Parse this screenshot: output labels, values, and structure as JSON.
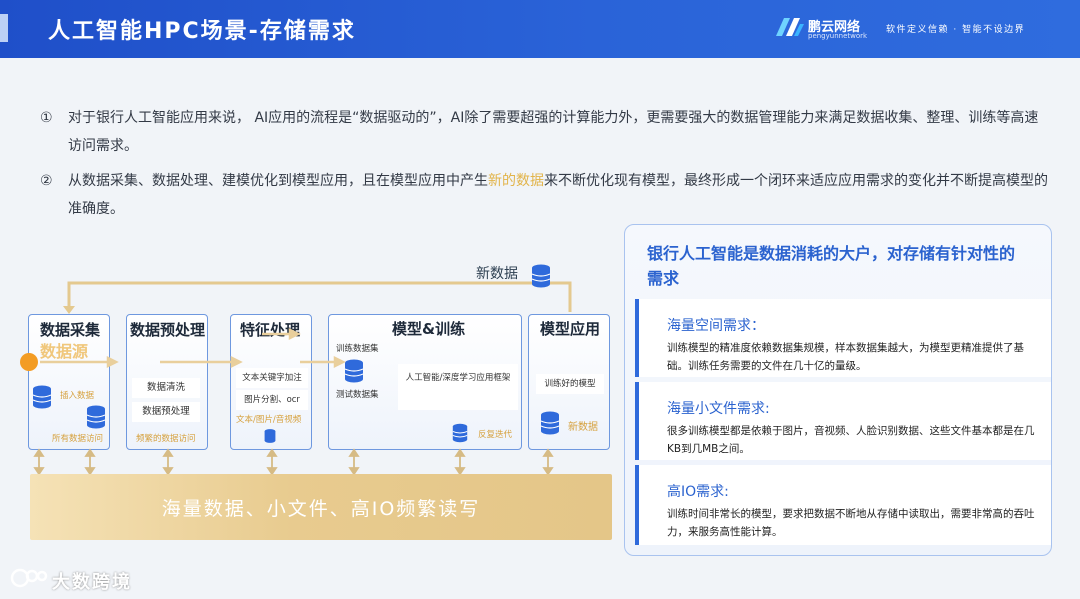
{
  "header": {
    "title": "人工智能HPC场景-存储需求",
    "brand": "鹏云网络",
    "brand_sub": "pengyunnetwork",
    "slogan": "软件定义信赖  ·  智能不设边界"
  },
  "points": [
    {
      "num": "①",
      "text": "对于银行人工智能应用来说， AI应用的流程是“数据驱动的”，AI除了需要超强的计算能力外，更需要强大的数据管理能力来满足数据收集、整理、训练等高速访问需求。"
    },
    {
      "num": "②",
      "text_before": "从数据采集、数据处理、建模优化到模型应用，且在模型应用中产生",
      "highlight": "新的数据",
      "text_after": "来不断优化现有模型，最终形成一个闭环来适应应用需求的变化并不断提高模型的准确度。"
    }
  ],
  "diagram": {
    "loop_label": "新数据",
    "collect": {
      "title": "数据采集",
      "big": "数据源",
      "insert": "插入数据",
      "access": "所有数据访问"
    },
    "preprocess": {
      "title": "数据预处理",
      "tags": [
        "数据清洗",
        "数据预处理"
      ],
      "frequent": "频繁的数据访问"
    },
    "feature": {
      "title": "特征处理",
      "items": [
        "文本关键字加注",
        "图片分割、ocr"
      ],
      "media": "文本/图片/音视频"
    },
    "train": {
      "title": "模型&训练",
      "train_set": "训练数据集",
      "test_set": "测试数据集",
      "framework": "人工智能/深度学习应用框架",
      "iterate": "反复迭代"
    },
    "apply": {
      "title": "模型应用",
      "trained": "训练好的模型",
      "new_data": "新数据"
    },
    "base": "海量数据、小文件、高IO频繁读写"
  },
  "panel": {
    "title": "银行人工智能是数据消耗的大户，对存储有针对性的需求",
    "requirements": [
      {
        "title": "海量空间需求：",
        "body": "训练模型的精准度依赖数据集规模，样本数据集越大，为模型更精准提供了基础。训练任务需要的文件在几十亿的量级。"
      },
      {
        "title": "海量小文件需求:",
        "body": "很多训练模型都是依赖于图片，音视频、人脸识别数据、这些文件基本都是在几KB到几MB之间。"
      },
      {
        "title": "高IO需求:",
        "body": "训练时间非常长的模型，要求把数据不断地从存储中读取出，需要非常高的吞吐力，来服务高性能计算。"
      }
    ]
  },
  "watermark": "大数跨境",
  "colors": {
    "header": "#2a63d8",
    "accent": "#2b63cf",
    "highlight": "#e2b44a",
    "gold": "#e8cb8f",
    "origin_dot": "#f39c24"
  },
  "icons": [
    "database-icon",
    "brand-logo-icon",
    "watermark-logo-icon"
  ]
}
